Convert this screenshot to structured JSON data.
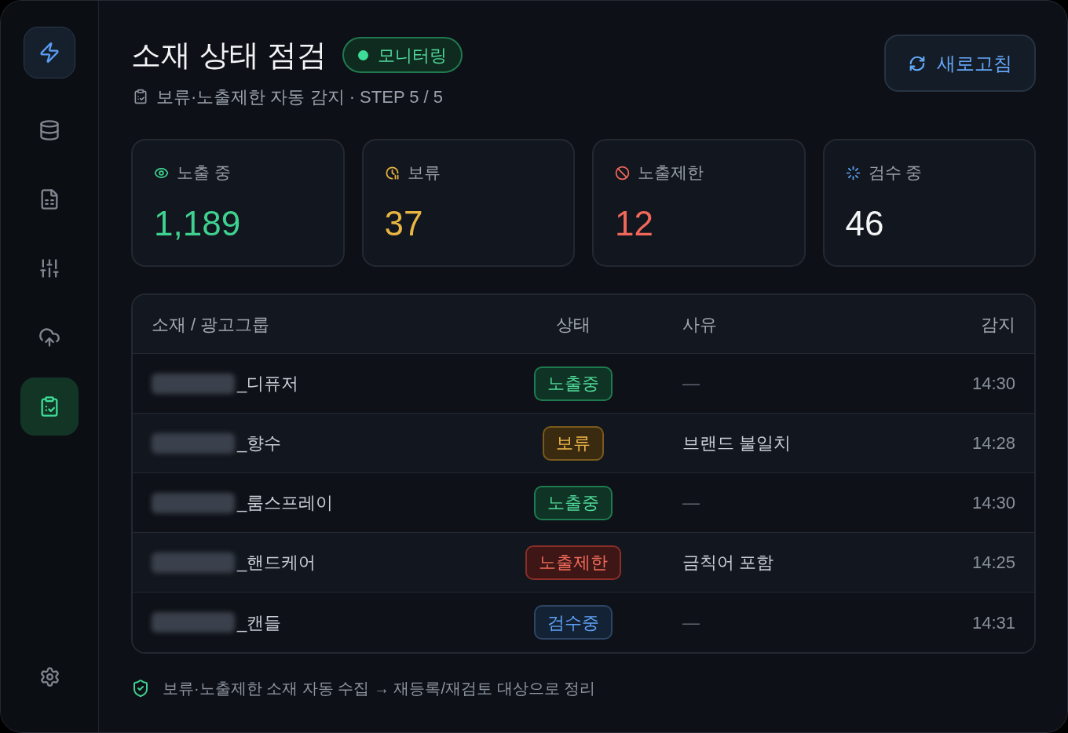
{
  "sidebar": {
    "items": [
      {
        "selected": false
      },
      {
        "selected": false
      },
      {
        "selected": false
      },
      {
        "selected": false
      },
      {
        "selected": true
      }
    ]
  },
  "header": {
    "title": "소재 상태 점검",
    "badge": {
      "label": "모니터링"
    },
    "subtitle": "보류·노출제한 자동 감지 · STEP 5 / 5",
    "refresh_button": "새로고침"
  },
  "stats": [
    {
      "label": "노출 중",
      "value": "1,189",
      "kind": "live"
    },
    {
      "label": "보류",
      "value": "37",
      "kind": "hold"
    },
    {
      "label": "노출제한",
      "value": "12",
      "kind": "restricted"
    },
    {
      "label": "검수 중",
      "value": "46",
      "kind": "review"
    }
  ],
  "table": {
    "columns": [
      "소재 / 광고그룹",
      "상태",
      "사유",
      "감지"
    ],
    "rows": [
      {
        "name": "_디퓨저",
        "status": {
          "label": "노출중",
          "kind": "live"
        },
        "reason": "—",
        "reason_greyed": true,
        "time": "14:30"
      },
      {
        "name": "_향수",
        "status": {
          "label": "보류",
          "kind": "hold"
        },
        "reason": "브랜드 불일치",
        "reason_greyed": false,
        "time": "14:28"
      },
      {
        "name": "_룸스프레이",
        "status": {
          "label": "노출중",
          "kind": "live"
        },
        "reason": "—",
        "reason_greyed": true,
        "time": "14:30"
      },
      {
        "name": "_핸드케어",
        "status": {
          "label": "노출제한",
          "kind": "restricted"
        },
        "reason": "금칙어 포함",
        "reason_greyed": false,
        "time": "14:25"
      },
      {
        "name": "_캔들",
        "status": {
          "label": "검수중",
          "kind": "review"
        },
        "reason": "—",
        "reason_greyed": true,
        "time": "14:31"
      }
    ]
  },
  "footer": {
    "note": "보류·노출제한 소재 자동 수집 → 재등록/재검토 대상으로 정리"
  }
}
